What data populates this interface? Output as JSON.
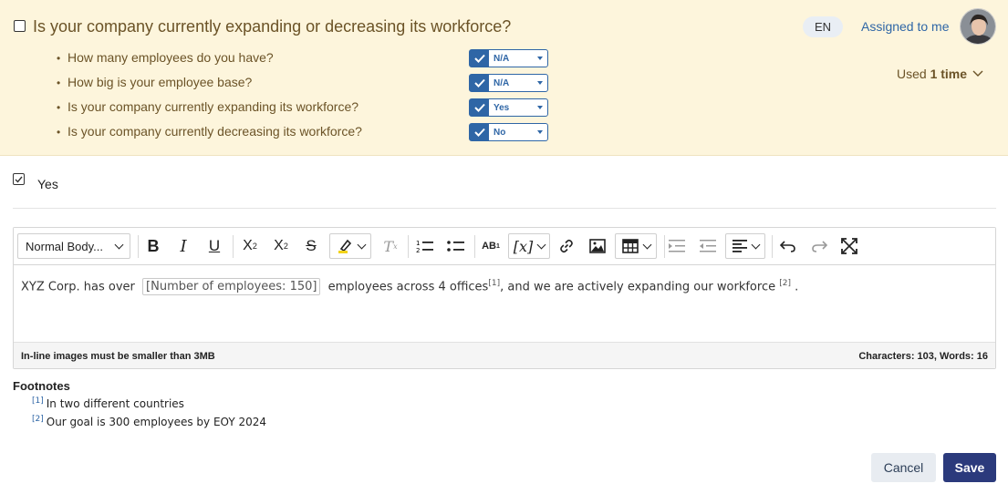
{
  "question": {
    "title": "Is your company currently expanding or decreasing its workforce?",
    "language": "EN",
    "assigned_label": "Assigned to me",
    "used_prefix": "Used",
    "used_count": "1 time",
    "sub_questions": [
      {
        "label": "How many employees do you have?",
        "value": "N/A"
      },
      {
        "label": "How big is your employee base?",
        "value": "N/A"
      },
      {
        "label": "Is your company currently expanding its workforce?",
        "value": "Yes"
      },
      {
        "label": "Is your company currently decreasing its workforce?",
        "value": "No"
      }
    ]
  },
  "answer": {
    "choice_label": "Yes",
    "checked": true
  },
  "editor": {
    "style_select": "Normal Body...",
    "content": {
      "part1": "XYZ Corp. has over",
      "placeholder": "[Number of employees: 150]",
      "part2": "employees across 4 offices",
      "fn1": "[1]",
      "part3": ", and we are actively expanding our workforce",
      "fn2": "[2]",
      "part4": "."
    },
    "status_left": "In-line images must be smaller than 3MB",
    "status_right": "Characters: 103, Words: 16"
  },
  "footnotes": {
    "title": "Footnotes",
    "items": [
      {
        "marker": "[1]",
        "text": "In two different countries"
      },
      {
        "marker": "[2]",
        "text": "Our goal is 300 employees by EOY 2024"
      }
    ]
  },
  "actions": {
    "cancel": "Cancel",
    "save": "Save"
  },
  "colors": {
    "header_bg": "#fdf5dc",
    "accent": "#2f66a6",
    "save_bg": "#2b3a7c"
  }
}
